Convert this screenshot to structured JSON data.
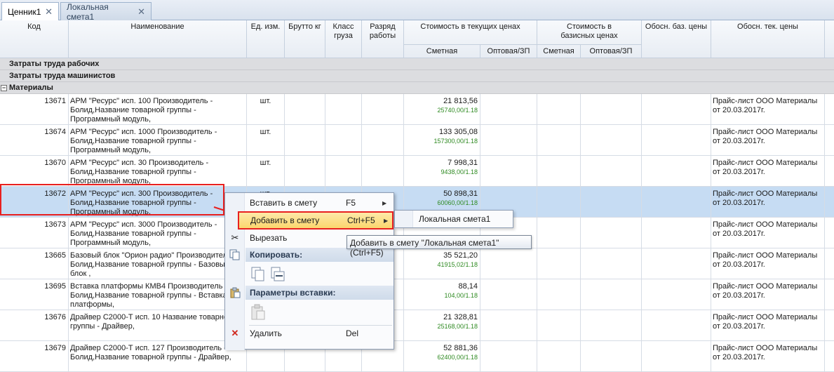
{
  "tabs": [
    {
      "label": "Ценник1",
      "close": "✕"
    },
    {
      "label": "Локальная смета1",
      "close": "✕"
    }
  ],
  "columns": {
    "code": "Код",
    "name": "Наименование",
    "unit": "Ед. изм.",
    "brutto": "Брутто кг",
    "class": "Класс груза",
    "razryad": "Разряд работы",
    "current_group": "Стоимость в текущих ценах",
    "current_smet": "Сметная",
    "current_opt": "Оптовая/ЗП",
    "base_group": "Стоимость в базисных ценах",
    "base_smet": "Сметная",
    "base_opt": "Оптовая/ЗП",
    "obosn_baz": "Обосн. баз. цены",
    "obosn_tek": "Обосн. тек. цены"
  },
  "groups": [
    {
      "label": "Затраты труда рабочих"
    },
    {
      "label": "Затраты труда машинистов"
    },
    {
      "label": "Материалы",
      "toggle": "−"
    }
  ],
  "rows": [
    {
      "code": "13671",
      "name": "АРМ \"Ресурс\" исп. 100 Производитель - Болид,Название товарной группы - Программный модуль,",
      "unit": "шт.",
      "smet": "21 813,56",
      "smet_sub": "25740,00/1.18",
      "obosn": "Прайс-лист ООО Материалы от 20.03.2017г."
    },
    {
      "code": "13674",
      "name": "АРМ \"Ресурс\" исп. 1000 Производитель - Болид,Название товарной группы - Программный модуль,",
      "unit": "шт.",
      "smet": "133 305,08",
      "smet_sub": "157300,00/1.18",
      "obosn": "Прайс-лист ООО Материалы от 20.03.2017г."
    },
    {
      "code": "13670",
      "name": "АРМ \"Ресурс\" исп. 30 Производитель - Болид,Название товарной группы - Программный модуль,",
      "unit": "шт.",
      "smet": "7 998,31",
      "smet_sub": "9438,00/1.18",
      "obosn": "Прайс-лист ООО Материалы от 20.03.2017г."
    },
    {
      "code": "13672",
      "name": "АРМ \"Ресурс\" исп. 300 Производитель - Болид,Название товарной группы - Программный модуль,",
      "unit": "шт.",
      "smet": "50 898,31",
      "smet_sub": "60060,00/1.18",
      "obosn": "Прайс-лист ООО Материалы от 20.03.2017г."
    },
    {
      "code": "13673",
      "name": "АРМ \"Ресурс\" исп. 3000 Производитель - Болид,Название товарной группы - Программный модуль,",
      "unit": "",
      "smet": "",
      "smet_sub": "",
      "obosn": "Прайс-лист ООО Материалы от 20.03.2017г."
    },
    {
      "code": "13665",
      "name": "Базовый блок \"Орион радио\" Производитель - Болид,Название товарной группы - Базовый блок ,",
      "unit": "",
      "smet": "35 521,20",
      "smet_sub": "41915,02/1.18",
      "obosn": "Прайс-лист ООО Материалы от 20.03.2017г."
    },
    {
      "code": "13695",
      "name": "Вставка платформы КМВ4 Производитель - Болид,Название товарной группы - Вставка платформы,",
      "unit": "",
      "smet": "88,14",
      "smet_sub": "104,00/1.18",
      "obosn": "Прайс-лист ООО Материалы от 20.03.2017г."
    },
    {
      "code": "13676",
      "name": "Драйвер С2000-Т исп. 10 Название товарной группы - Драйвер,",
      "unit": "",
      "smet": "21 328,81",
      "smet_sub": "25168,00/1.18",
      "obosn": "Прайс-лист ООО Материалы от 20.03.2017г."
    },
    {
      "code": "13679",
      "name": "Драйвер С2000-Т исп. 127 Производитель - Болид,Название товарной группы - Драйвер,",
      "unit": "",
      "smet": "52 881,36",
      "smet_sub": "62400,00/1.18",
      "obosn": "Прайс-лист ООО Материалы от 20.03.2017г."
    }
  ],
  "context_menu": {
    "insert": {
      "label": "Вставить в смету",
      "key": "F5"
    },
    "add": {
      "label": "Добавить в смету",
      "key": "Ctrl+F5"
    },
    "cut": {
      "label": "Вырезать"
    },
    "copy_header": "Копировать:",
    "paste_header": "Параметры вставки:",
    "delete": {
      "label": "Удалить",
      "key": "Del"
    }
  },
  "submenu": {
    "item": "Локальная смета1"
  },
  "tooltip": "Добавить в смету \"Локальная смета1\" (Ctrl+F5)",
  "colors": {
    "highlight_border": "#e8201f",
    "selected_row": "#c6dcf3",
    "sub_value": "#2e8a21"
  }
}
